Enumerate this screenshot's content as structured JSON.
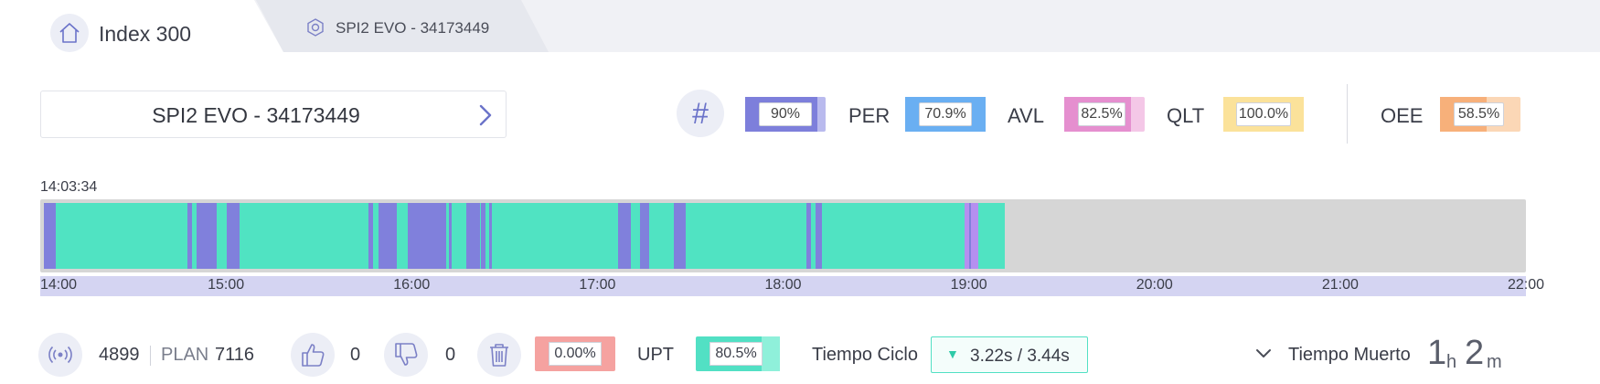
{
  "tabs": {
    "home_title": "Index 300",
    "machine_tab_label": "SPI2 EVO - 34173449"
  },
  "machine_selector": {
    "label": "SPI2 EVO - 34173449"
  },
  "kpis": {
    "hash_symbol": "#",
    "items": [
      {
        "id": "base",
        "label": "",
        "value": "90%",
        "fill": 0.9,
        "color": "#7d7fdb",
        "rest_color": "#b9baee"
      },
      {
        "id": "per",
        "label": "PER",
        "value": "70.9%",
        "fill": 1.0,
        "color": "#6aaff2",
        "rest_color": "#6aaff2"
      },
      {
        "id": "avl",
        "label": "AVL",
        "value": "82.5%",
        "fill": 0.825,
        "color": "#e58fcf",
        "rest_color": "#f4c7e7"
      },
      {
        "id": "qlt",
        "label": "QLT",
        "value": "100.0%",
        "fill": 1.0,
        "color": "#fbe29a",
        "rest_color": "#fbe29a"
      },
      {
        "id": "oee",
        "label": "OEE",
        "value": "58.5%",
        "fill": 0.585,
        "color": "#f7b07a",
        "rest_color": "#fbd7b6"
      }
    ]
  },
  "timeline": {
    "start_label": "14:03:34",
    "axis_start_hours": 14,
    "axis_end_hours": 22,
    "ticks": [
      "14:00",
      "15:00",
      "16:00",
      "17:00",
      "18:00",
      "19:00",
      "20:00",
      "21:00",
      "22:00"
    ],
    "colors": {
      "run": "#50e3c2",
      "stop": "#8080dc",
      "other": "#b58ff0",
      "empty": "#d6d6d6"
    },
    "segments": [
      {
        "state": "stop",
        "start": "14:00:00",
        "end": "14:04:00"
      },
      {
        "state": "run",
        "start": "14:04:00",
        "end": "14:46:30"
      },
      {
        "state": "stop",
        "start": "14:46:30",
        "end": "14:48:00"
      },
      {
        "state": "run",
        "start": "14:48:00",
        "end": "14:49:30"
      },
      {
        "state": "stop",
        "start": "14:49:30",
        "end": "14:56:00"
      },
      {
        "state": "run",
        "start": "14:56:00",
        "end": "14:59:30"
      },
      {
        "state": "stop",
        "start": "14:59:30",
        "end": "15:03:30"
      },
      {
        "state": "run",
        "start": "15:03:30",
        "end": "15:45:30"
      },
      {
        "state": "stop",
        "start": "15:45:30",
        "end": "15:47:00"
      },
      {
        "state": "run",
        "start": "15:47:00",
        "end": "15:48:30"
      },
      {
        "state": "stop",
        "start": "15:48:30",
        "end": "15:54:30"
      },
      {
        "state": "run",
        "start": "15:54:30",
        "end": "15:58:00"
      },
      {
        "state": "stop",
        "start": "15:58:00",
        "end": "16:10:30"
      },
      {
        "state": "run",
        "start": "16:10:30",
        "end": "16:11:30"
      },
      {
        "state": "stop",
        "start": "16:11:30",
        "end": "16:12:30"
      },
      {
        "state": "run",
        "start": "16:12:30",
        "end": "16:17:00"
      },
      {
        "state": "stop",
        "start": "16:17:00",
        "end": "16:21:30"
      },
      {
        "state": "run",
        "start": "16:21:30",
        "end": "16:22:00"
      },
      {
        "state": "stop",
        "start": "16:22:00",
        "end": "16:23:30"
      },
      {
        "state": "run",
        "start": "16:23:30",
        "end": "16:24:30"
      },
      {
        "state": "stop",
        "start": "16:24:30",
        "end": "16:25:30"
      },
      {
        "state": "run",
        "start": "16:25:30",
        "end": "17:06:30"
      },
      {
        "state": "stop",
        "start": "17:06:30",
        "end": "17:10:30"
      },
      {
        "state": "run",
        "start": "17:10:30",
        "end": "17:13:30"
      },
      {
        "state": "stop",
        "start": "17:13:30",
        "end": "17:16:30"
      },
      {
        "state": "run",
        "start": "17:16:30",
        "end": "17:24:30"
      },
      {
        "state": "stop",
        "start": "17:24:30",
        "end": "17:28:30"
      },
      {
        "state": "run",
        "start": "17:28:30",
        "end": "18:07:30"
      },
      {
        "state": "stop",
        "start": "18:07:30",
        "end": "18:09:00"
      },
      {
        "state": "run",
        "start": "18:09:00",
        "end": "18:10:30"
      },
      {
        "state": "stop",
        "start": "18:10:30",
        "end": "18:12:30"
      },
      {
        "state": "run",
        "start": "18:12:30",
        "end": "18:59:00"
      },
      {
        "state": "other",
        "start": "18:59:00",
        "end": "19:00:30"
      },
      {
        "state": "stop",
        "start": "19:00:30",
        "end": "19:01:00"
      },
      {
        "state": "other",
        "start": "19:01:00",
        "end": "19:03:30"
      },
      {
        "state": "run",
        "start": "19:03:30",
        "end": "19:12:00"
      }
    ]
  },
  "bottom": {
    "produced": "4899",
    "plan_label": "PLAN",
    "plan_value": "7116",
    "good_count": "0",
    "bad_count": "0",
    "scrap_pct": "0.00%",
    "upt_label": "UPT",
    "upt_value": "80.5%",
    "upt_fill": 0.805,
    "cycle_label": "Tiempo Ciclo",
    "cycle_value": "3.22s  /  3.44s",
    "dead_label": "Tiempo Muerto",
    "dead_hours": "1",
    "dead_hours_unit": "h",
    "dead_minutes": "2",
    "dead_minutes_unit": "m"
  }
}
